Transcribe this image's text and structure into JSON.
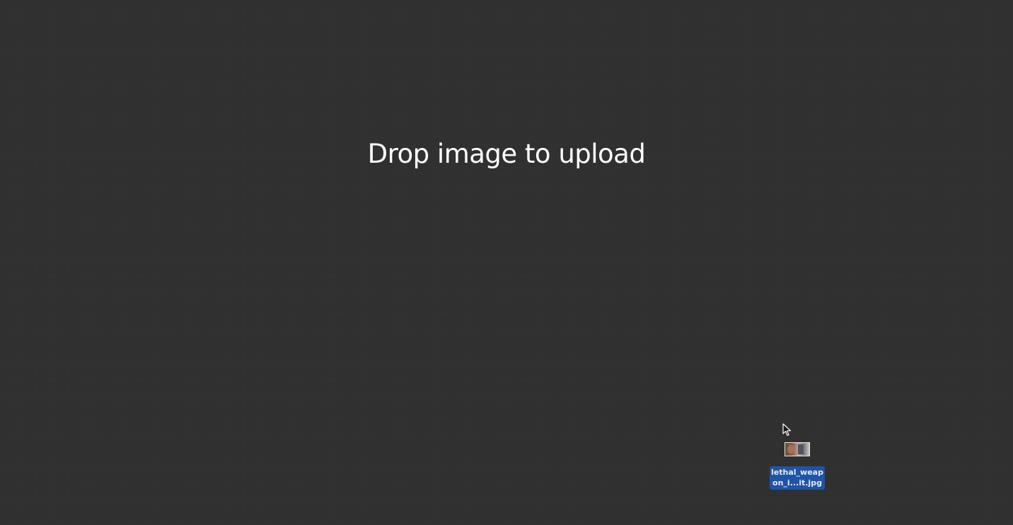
{
  "drop_zone": {
    "heading": "Drop image to upload"
  },
  "dragged_file": {
    "label_line1": "lethal_weap",
    "label_line2": "on_i...it.jpg",
    "thumbnail_icon": "image-thumbnail-icon"
  },
  "cursor": {
    "icon": "arrow-cursor-icon"
  },
  "colors": {
    "background": "#313131",
    "heading_text": "#ffffff",
    "file_label_highlight": "#1d58b8"
  }
}
